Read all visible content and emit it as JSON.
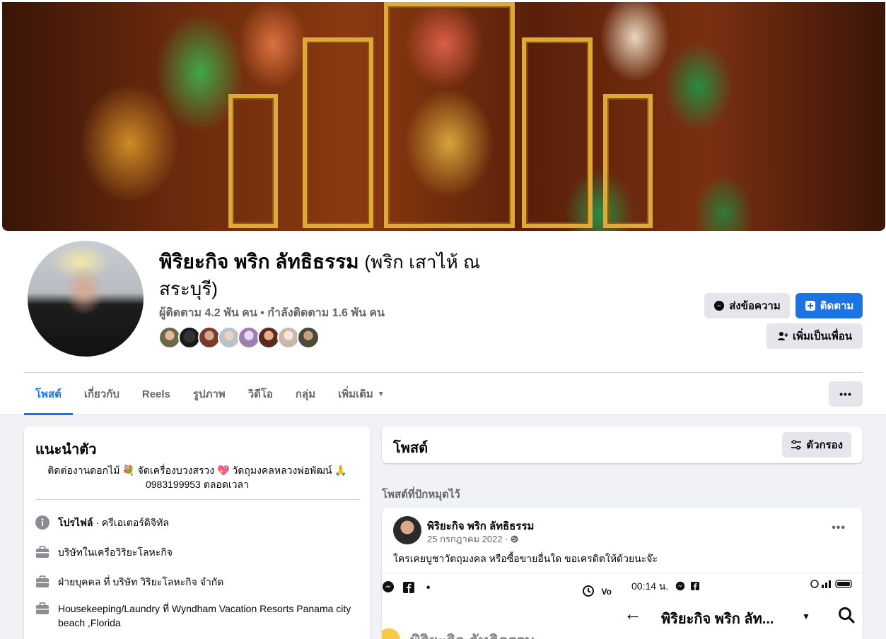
{
  "profile": {
    "name": "พิริยะกิจ พริก ลัทธิธรรม",
    "alt_name": "(พริก เสาไห้ ณ สระบุรี)",
    "stats": "ผู้ติดตาม 4.2 พัน คน • กำลังติดตาม 1.6 พัน คน"
  },
  "actions": {
    "message": "ส่งข้อความ",
    "follow": "ติดตาม",
    "add_friend": "เพิ่มเป็นเพื่อน"
  },
  "tabs": [
    "โพสต์",
    "เกี่ยวกับ",
    "Reels",
    "รูปภาพ",
    "วิดีโอ",
    "กลุ่ม",
    "เพิ่มเติม"
  ],
  "more_dots": "•••",
  "intro": {
    "title": "แนะนำตัว",
    "bio_line1": "ติดต่องานดอกไม้ 💐 จัดเครื่องบวงสรวง 💖 วัดถุมงคลหลวงพ่อพัฒน์ 🙏",
    "bio_line2": "0983199953 ตลอดเวลา",
    "profile_label": "โปรไฟล์",
    "profile_value": " · ครีเอเตอร์ดิจิทัล",
    "work1": "บริษัทในเครือวิริยะโลหะกิจ",
    "work2": "ฝ่ายบุคคล ที่ บริษัท วิริยะโลหะกิจ จำกัด",
    "work3": "Housekeeping/Laundry ที่ Wyndham Vacation Resorts Panama city beach ,Florida"
  },
  "posts": {
    "title": "โพสต์",
    "filter": "ตัวกรอง",
    "pinned_label": "โพสต์ที่ปักหมุดไว้"
  },
  "post": {
    "author": "พิริยะกิจ พริก ลัทธิธรรม",
    "date": "25 กรกฎาคม 2022 ·",
    "text": "ใครเคยบูชาวัตถุมงคล หรือซื้อขายอื่นใด ขอเครดิตให้ด้วยนะจ๊ะ",
    "more": "•••",
    "shot_time": "00:14 น.",
    "shot_name": "พิริยะกิจ พริก ลัท...",
    "shot_blur": "พิริยะกิจ ลัทธิธรรม"
  },
  "colors": {
    "accent": "#1b74e4",
    "secondary_text": "#65676b",
    "button_gray": "#e4e6eb"
  }
}
